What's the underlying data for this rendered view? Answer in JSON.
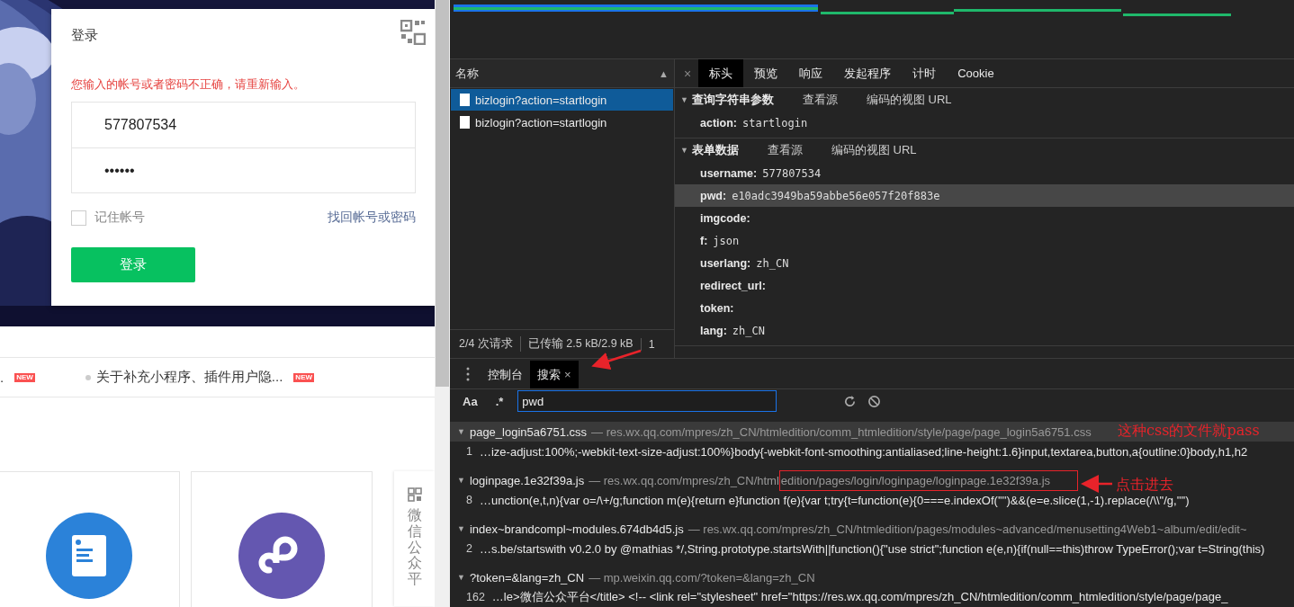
{
  "login": {
    "title": "登录",
    "error": "您输入的帐号或者密码不正确，请重新输入。",
    "username": "577807534",
    "password": "••••••",
    "remember": {
      "label": "记住帐号",
      "checked": false
    },
    "forgot": "找回帐号或密码",
    "submit": "登录"
  },
  "news": [
    {
      "text": ".",
      "badge": "NEW"
    },
    {
      "text": "关于补充小程序、插件用户隐...",
      "badge": "NEW"
    }
  ],
  "side_float": {
    "label": "微信公众平"
  },
  "devtools": {
    "requests": {
      "header": "名称",
      "sort": "▲",
      "items": [
        {
          "name": "bizlogin?action=startlogin",
          "selected": true
        },
        {
          "name": "bizlogin?action=startlogin",
          "selected": false
        }
      ],
      "status": [
        "2/4 次请求",
        "已传输 2.5 kB/2.9 kB",
        "1"
      ]
    },
    "close": "×",
    "expand_icon": "▼",
    "detail_tabs": [
      {
        "label": "标头",
        "selected": true
      },
      {
        "label": "预览",
        "selected": false
      },
      {
        "label": "响应",
        "selected": false
      },
      {
        "label": "发起程序",
        "selected": false
      },
      {
        "label": "计时",
        "selected": false
      },
      {
        "label": "Cookie",
        "selected": false
      }
    ],
    "sections": [
      {
        "title": "查询字符串参数",
        "expanded": true,
        "actions": [
          "查看源",
          "编码的视图 URL"
        ],
        "params": [
          {
            "key": "action:",
            "value": "startlogin",
            "selected": false
          }
        ]
      },
      {
        "title": "表单数据",
        "expanded": true,
        "actions": [
          "查看源",
          "编码的视图 URL"
        ],
        "params": [
          {
            "key": "username:",
            "value": "577807534",
            "selected": false
          },
          {
            "key": "pwd:",
            "value": "e10adc3949ba59abbe56e057f20f883e",
            "selected": true
          },
          {
            "key": "imgcode:",
            "selected": false
          },
          {
            "key": "f:",
            "value": "json",
            "selected": false
          },
          {
            "key": "userlang:",
            "value": "zh_CN",
            "selected": false
          },
          {
            "key": "redirect_url:",
            "selected": false
          },
          {
            "key": "token:",
            "selected": false
          },
          {
            "key": "lang:",
            "value": "zh_CN",
            "selected": false
          }
        ]
      }
    ],
    "drawer_tabs": [
      {
        "label": "控制台",
        "selected": false,
        "closable": false
      },
      {
        "label": "搜索",
        "selected": true,
        "closable": true
      }
    ],
    "search": {
      "case": "Aa",
      "regex": ".*",
      "value": "pwd"
    },
    "results": [
      {
        "file": "page_login5a6751.css",
        "url": "— res.wx.qq.com/mpres/zh_CN/htmledition/comm_htmledition/style/page/page_login5a6751.css",
        "line": "1",
        "match": "…ize-adjust:100%;-webkit-text-size-adjust:100%}body{-webkit-font-smoothing:antialiased;line-height:1.6}input,textarea,button,a{outline:0}body,h1,h2",
        "selected": true
      },
      {
        "file": "loginpage.1e32f39a.js",
        "url": "— res.wx.qq.com/mpres/zh_CN/html",
        "url_highlight": "edition/pages/login/loginpage/loginpage.1e32f39a.js",
        "line": "8",
        "match": "…unction(e,t,n){var o=/\\+/g;function m(e){return e}function f(e){var t;try{t=function(e){0===e.indexOf('\"')&&(e=e.slice(1,-1).replace(/\\\\\"/g,'\"')",
        "selected": false
      },
      {
        "file": "index~brandcompl~modules.674db4d5.js",
        "url": "— res.wx.qq.com/mpres/zh_CN/htmledition/pages/modules~advanced/menusetting4Web1~album/edit/edit~",
        "line": "2",
        "match": "…s.be/startswith v0.2.0 by @mathias */,String.prototype.startsWith||function(){\"use strict\";function e(e,n){if(null==this)throw TypeError();var t=String(this)",
        "selected": false
      },
      {
        "file": "?token=&lang=zh_CN",
        "url": "— mp.weixin.qq.com/?token=&lang=zh_CN",
        "line": "162",
        "match": "…le>微信公众平台</title>  <!-- <link rel=\"stylesheet\" href=\"https://res.wx.qq.com/mpres/zh_CN/htmledition/comm_htmledition/style/page/page_",
        "selected": false
      }
    ]
  },
  "annotations": [
    {
      "text": "这种css的文件就pass"
    },
    {
      "text": "点击进去"
    }
  ]
}
